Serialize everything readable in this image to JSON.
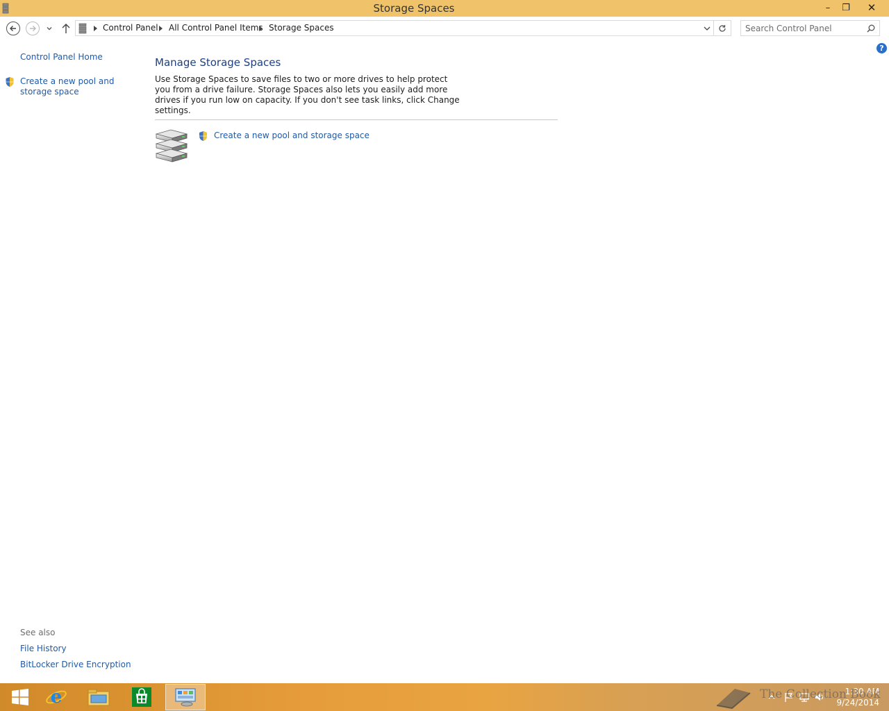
{
  "window": {
    "title": "Storage Spaces",
    "min_glyph": "–",
    "max_glyph": "❐",
    "close_glyph": "✕"
  },
  "address": {
    "crumbs": [
      "Control Panel",
      "All Control Panel Items",
      "Storage Spaces"
    ]
  },
  "search": {
    "placeholder": "Search Control Panel"
  },
  "sidebar": {
    "home": "Control Panel Home",
    "task": "Create a new pool and storage space",
    "see_also_heading": "See also",
    "see_also": [
      "File History",
      "BitLocker Drive Encryption"
    ]
  },
  "main": {
    "title": "Manage Storage Spaces",
    "description": "Use Storage Spaces to save files to two or more drives to help protect you from a drive failure. Storage Spaces also lets you easily add more drives if you run low on capacity. If you don't see task links, click Change settings.",
    "task": "Create a new pool and storage space",
    "help_glyph": "?"
  },
  "taskbar": {
    "clock_time": "1:30 AM",
    "clock_date": "9/24/2014",
    "apps": [
      "start-icon",
      "internet-explorer-icon",
      "file-explorer-icon",
      "store-icon",
      "control-panel-icon"
    ]
  },
  "watermark": {
    "text": "The Collection Book"
  },
  "colors": {
    "titlebar": "#f0c36a",
    "link": "#1e5aa8",
    "heading": "#1e3f80",
    "taskbar": "#e69c3a"
  }
}
